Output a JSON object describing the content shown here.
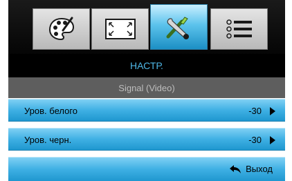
{
  "tabs": [
    {
      "icon": "palette-icon",
      "active": false
    },
    {
      "icon": "screen-resize-icon",
      "active": false
    },
    {
      "icon": "tools-icon",
      "active": true
    },
    {
      "icon": "list-icon",
      "active": false
    }
  ],
  "menu": {
    "title": "НАСТР.",
    "subtitle": "Signal (Video)",
    "items": [
      {
        "label": "Уров. белого",
        "value": "-30"
      },
      {
        "label": "Уров. черн.",
        "value": "-30"
      }
    ]
  },
  "footer": {
    "exit_label": "Выход"
  },
  "colors": {
    "accent": "#4fb7e6",
    "row_blue": "#3fb0e4",
    "subtitle_bg": "#5e5e5e"
  }
}
